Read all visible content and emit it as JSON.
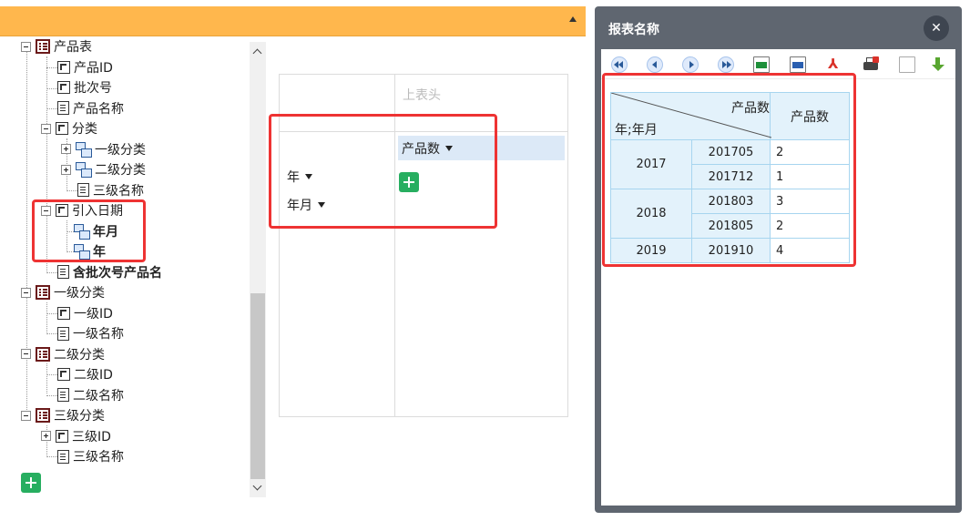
{
  "tree": {
    "items": [
      {
        "label": "产品表",
        "kind": "table",
        "level": 0,
        "expanded": true
      },
      {
        "label": "产品ID",
        "kind": "dimension",
        "level": 1
      },
      {
        "label": "批次号",
        "kind": "dimension",
        "level": 1
      },
      {
        "label": "产品名称",
        "kind": "measure",
        "level": 1
      },
      {
        "label": "分类",
        "kind": "dimension",
        "level": 1,
        "expanded": true
      },
      {
        "label": "一级分类",
        "kind": "hierarchy",
        "level": 2,
        "expanded": false
      },
      {
        "label": "二级分类",
        "kind": "hierarchy",
        "level": 2,
        "expanded": false
      },
      {
        "label": "三级名称",
        "kind": "measure",
        "level": 2
      },
      {
        "label": "引入日期",
        "kind": "dimension",
        "level": 1,
        "expanded": true
      },
      {
        "label": "年月",
        "kind": "hierarchy",
        "level": 2,
        "bold": true
      },
      {
        "label": "年",
        "kind": "hierarchy",
        "level": 2,
        "bold": true
      },
      {
        "label": "含批次号产品名",
        "kind": "measure",
        "level": 1,
        "bold": true
      },
      {
        "label": "一级分类",
        "kind": "table",
        "level": 0,
        "expanded": true
      },
      {
        "label": "一级ID",
        "kind": "dimension",
        "level": 1
      },
      {
        "label": "一级名称",
        "kind": "measure",
        "level": 1
      },
      {
        "label": "二级分类",
        "kind": "table",
        "level": 0,
        "expanded": true
      },
      {
        "label": "二级ID",
        "kind": "dimension",
        "level": 1
      },
      {
        "label": "二级名称",
        "kind": "measure",
        "level": 1
      },
      {
        "label": "三级分类",
        "kind": "table",
        "level": 0,
        "expanded": true
      },
      {
        "label": "三级ID",
        "kind": "dimension",
        "level": 1,
        "expanded": false
      },
      {
        "label": "三级名称",
        "kind": "measure",
        "level": 1
      }
    ]
  },
  "designer": {
    "column_header_placeholder": "上表头",
    "row_fields": [
      "年",
      "年月"
    ],
    "measure_fields": [
      "产品数"
    ]
  },
  "preview": {
    "title": "报表名称",
    "close_label": "✕",
    "toolbar": [
      "first-page-icon",
      "prev-page-icon",
      "next-page-icon",
      "last-page-icon",
      "export-excel-icon",
      "export-word-icon",
      "export-pdf-icon",
      "print-icon",
      "export-text-icon",
      "download-icon"
    ],
    "table": {
      "corner_top": "产品数",
      "corner_bottom": "年;年月",
      "measure_header": "产品数",
      "groups": [
        {
          "year": "2017",
          "rows": [
            {
              "ym": "201705",
              "value": "2"
            },
            {
              "ym": "201712",
              "value": "1"
            }
          ]
        },
        {
          "year": "2018",
          "rows": [
            {
              "ym": "201803",
              "value": "3"
            },
            {
              "ym": "201805",
              "value": "2"
            }
          ]
        },
        {
          "year": "2019",
          "rows": [
            {
              "ym": "201910",
              "value": "4"
            }
          ]
        }
      ]
    }
  },
  "colors": {
    "header_bar": "#ffb74d",
    "accent_green": "#27ae60",
    "highlight_red": "#ee3333",
    "cell_border": "#a7d5ef"
  }
}
